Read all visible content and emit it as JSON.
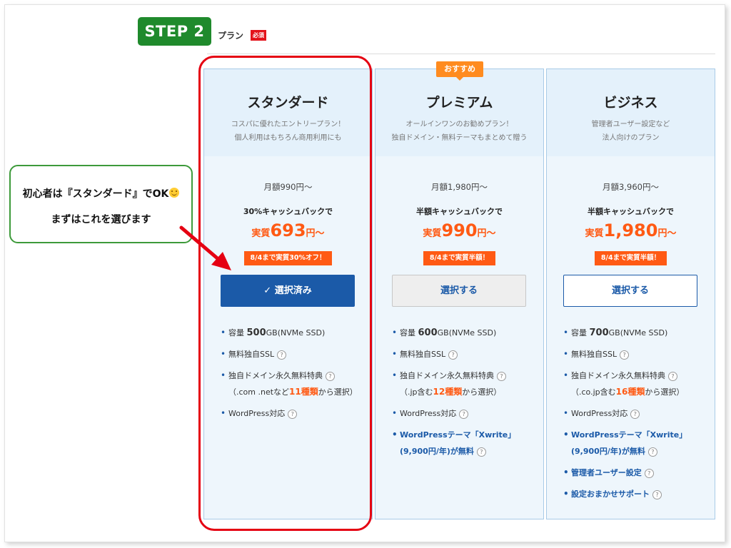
{
  "header": {
    "step_label": "STEP 2",
    "section_label": "プラン",
    "required_label": "必須"
  },
  "recommend_label": "おすすめ",
  "callout": {
    "line1": "初心者は『スタンダード』でOK",
    "line2": "まずはこれを選びます",
    "emoji_icon": "smile-icon"
  },
  "plans": {
    "standard": {
      "name": "スタンダード",
      "desc1": "コスパに優れたエントリープラン！",
      "desc2": "個人利用はもちろん商用利用にも",
      "monthly": "月額990円〜",
      "cashback": "30%キャッシュバックで",
      "eff_prefix": "実質",
      "eff_amount": "693",
      "eff_suffix": "円〜",
      "promo": "8/4まで実質30%オフ！",
      "button": "✓ 選択済み",
      "button_state": "selected",
      "f1_pre": "容量 ",
      "f1_big": "500",
      "f1_post": "GB(NVMe SSD)",
      "f2": "無料独自SSL",
      "f3a": "独自ドメイン永久無料特典",
      "f3b_pre": "（.com .netなど",
      "f3b_num": "11種類",
      "f3b_post": "から選択）",
      "f4": "WordPress対応"
    },
    "premium": {
      "name": "プレミアム",
      "desc1": "オールインワンのお勧めプラン！",
      "desc2": "独自ドメイン・無料テーマもまとめて贈う",
      "monthly": "月額1,980円〜",
      "cashback": "半額キャッシュバックで",
      "eff_prefix": "実質",
      "eff_amount": "990",
      "eff_suffix": "円〜",
      "promo": "8/4まで実質半額！",
      "button": "選択する",
      "f1_pre": "容量 ",
      "f1_big": "600",
      "f1_post": "GB(NVMe SSD)",
      "f2": "無料独自SSL",
      "f3a": "独自ドメイン永久無料特典",
      "f3b_pre": "（.jp含む",
      "f3b_num": "12種類",
      "f3b_post": "から選択）",
      "f4": "WordPress対応",
      "f5a": "WordPressテーマ「Xwrite」",
      "f5b": "(9,900円/年)が無料"
    },
    "business": {
      "name": "ビジネス",
      "desc1": "管理者ユーザー設定など",
      "desc2": "法人向けのプラン",
      "monthly": "月額3,960円〜",
      "cashback": "半額キャッシュバックで",
      "eff_prefix": "実質",
      "eff_amount": "1,980",
      "eff_suffix": "円〜",
      "promo": "8/4まで実質半額！",
      "button": "選択する",
      "f1_pre": "容量 ",
      "f1_big": "700",
      "f1_post": "GB(NVMe SSD)",
      "f2": "無料独自SSL",
      "f3a": "独自ドメイン永久無料特典",
      "f3b_pre": "（.co.jp含む",
      "f3b_num": "16種類",
      "f3b_post": "から選択）",
      "f4": "WordPress対応",
      "f5a": "WordPressテーマ「Xwrite」",
      "f5b": "(9,900円/年)が無料",
      "f6": "管理者ユーザー設定",
      "f7": "設定おまかせサポート"
    }
  },
  "help_icon_glyph": "?",
  "colors": {
    "brand_blue": "#1b5aa8",
    "accent_orange": "#ff5a14",
    "step_green": "#1f8a2c",
    "highlight_red": "#e50012",
    "callout_green": "#3d9a3a"
  }
}
